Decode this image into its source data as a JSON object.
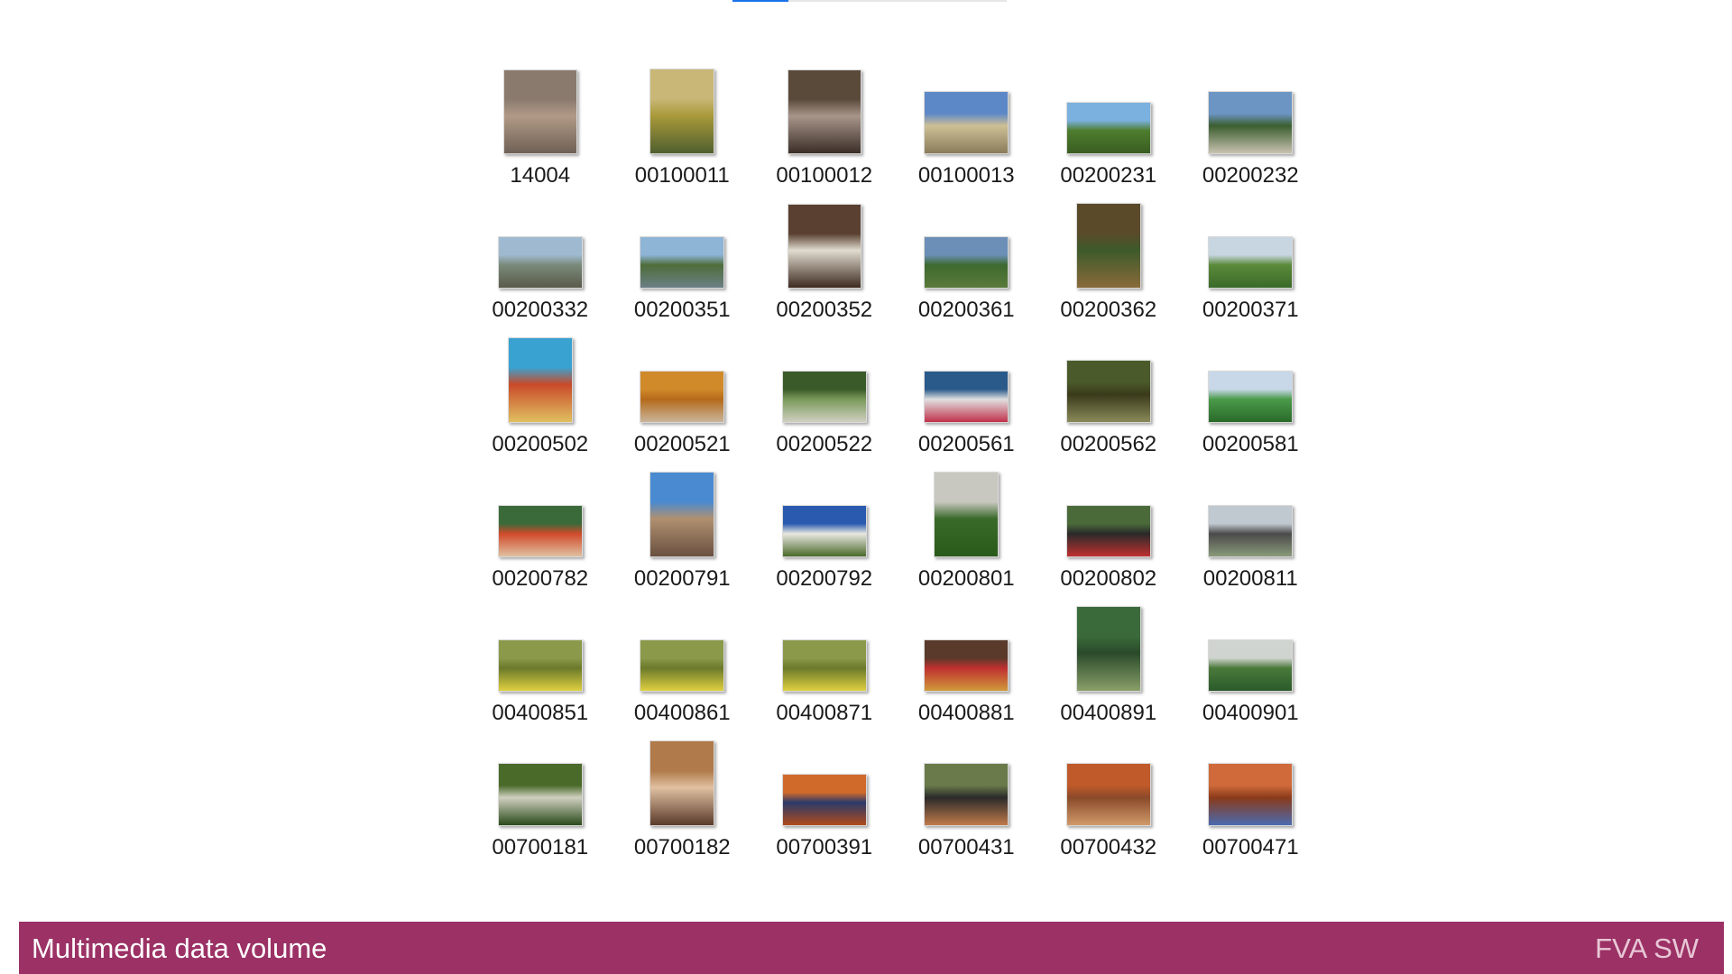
{
  "files": [
    {
      "name": "14004",
      "shape": "sq",
      "colors": [
        "#8a7a6e",
        "#b19a86",
        "#6f6156"
      ]
    },
    {
      "name": "00100011",
      "shape": "port",
      "colors": [
        "#c9b777",
        "#aa9a3a",
        "#4f5f2f"
      ]
    },
    {
      "name": "00100012",
      "shape": "sq",
      "colors": [
        "#5a4a3a",
        "#a8958a",
        "#3a2e28"
      ]
    },
    {
      "name": "00100013",
      "shape": "land",
      "colors": [
        "#5d88c7",
        "#cdbf95",
        "#8a7c5a"
      ]
    },
    {
      "name": "00200231",
      "shape": "wide",
      "colors": [
        "#7bb1de",
        "#4e7d2e",
        "#3a5d22"
      ]
    },
    {
      "name": "00200232",
      "shape": "land",
      "colors": [
        "#6c95c4",
        "#3b5e2f",
        "#c8c2b0"
      ]
    },
    {
      "name": "00200332",
      "shape": "wide",
      "colors": [
        "#9fbad0",
        "#7a8a7a",
        "#5a5a4a"
      ]
    },
    {
      "name": "00200351",
      "shape": "wide",
      "colors": [
        "#8eb4d6",
        "#4e6d3a",
        "#6b7f86"
      ]
    },
    {
      "name": "00200352",
      "shape": "sq",
      "colors": [
        "#5a4030",
        "#e0dccf",
        "#3e2a20"
      ]
    },
    {
      "name": "00200361",
      "shape": "wide",
      "colors": [
        "#6b8fb7",
        "#3d6a2f",
        "#5a7a3a"
      ]
    },
    {
      "name": "00200362",
      "shape": "port",
      "colors": [
        "#5a4a2a",
        "#3d5a2a",
        "#8a6a3a"
      ]
    },
    {
      "name": "00200371",
      "shape": "wide",
      "colors": [
        "#c8d6e2",
        "#5b8a3a",
        "#3a6a2a"
      ]
    },
    {
      "name": "00200502",
      "shape": "port",
      "colors": [
        "#3aa2d0",
        "#c94a2a",
        "#e0c060"
      ]
    },
    {
      "name": "00200521",
      "shape": "wide",
      "colors": [
        "#d08a2a",
        "#b46a1a",
        "#c9b59a"
      ]
    },
    {
      "name": "00200522",
      "shape": "wide",
      "colors": [
        "#3a5a2a",
        "#7a9a5a",
        "#d0d0c0"
      ]
    },
    {
      "name": "00200561",
      "shape": "wide",
      "colors": [
        "#2a5a8a",
        "#e0e0e0",
        "#c0304a"
      ]
    },
    {
      "name": "00200562",
      "shape": "land",
      "colors": [
        "#4a5a2a",
        "#3a3a1a",
        "#8a8a5a"
      ]
    },
    {
      "name": "00200581",
      "shape": "wide",
      "colors": [
        "#c8d8e8",
        "#4a9a4a",
        "#2a6a2a"
      ]
    },
    {
      "name": "00200782",
      "shape": "wide",
      "colors": [
        "#3a6a3a",
        "#d04a2a",
        "#e0c0a0"
      ]
    },
    {
      "name": "00200791",
      "shape": "port",
      "colors": [
        "#4a8ad0",
        "#b09070",
        "#6a5040"
      ]
    },
    {
      "name": "00200792",
      "shape": "wide",
      "colors": [
        "#2a5ab0",
        "#e8e8e0",
        "#4a6a2a"
      ]
    },
    {
      "name": "00200801",
      "shape": "port",
      "colors": [
        "#c8c8c0",
        "#3a6a2a",
        "#2a5a1a"
      ]
    },
    {
      "name": "00200802",
      "shape": "wide",
      "colors": [
        "#4a6a3a",
        "#2a2a2a",
        "#c03030"
      ]
    },
    {
      "name": "00200811",
      "shape": "wide",
      "colors": [
        "#c0c8d0",
        "#4a4a4a",
        "#8a9a7a"
      ]
    },
    {
      "name": "00400851",
      "shape": "wide",
      "colors": [
        "#8a9a4a",
        "#6a7a2a",
        "#e0d040"
      ]
    },
    {
      "name": "00400861",
      "shape": "wide",
      "colors": [
        "#8a9a4a",
        "#6a7a2a",
        "#e0d040"
      ]
    },
    {
      "name": "00400871",
      "shape": "wide",
      "colors": [
        "#8a9a4a",
        "#6a7a2a",
        "#e0d040"
      ]
    },
    {
      "name": "00400881",
      "shape": "wide",
      "colors": [
        "#5a3a2a",
        "#c03030",
        "#d09a3a"
      ]
    },
    {
      "name": "00400891",
      "shape": "port",
      "colors": [
        "#3a6a3a",
        "#2a4a2a",
        "#8aa06a"
      ]
    },
    {
      "name": "00400901",
      "shape": "wide",
      "colors": [
        "#d0d4d0",
        "#4a7a3a",
        "#2a5a2a"
      ]
    },
    {
      "name": "00700181",
      "shape": "land",
      "colors": [
        "#4a6a2a",
        "#d0d0c0",
        "#2a4a1a"
      ]
    },
    {
      "name": "00700182",
      "shape": "port",
      "colors": [
        "#b07a4a",
        "#e0c0a0",
        "#5a3a2a"
      ]
    },
    {
      "name": "00700391",
      "shape": "wide",
      "colors": [
        "#d06a2a",
        "#2a3a6a",
        "#b04a1a"
      ]
    },
    {
      "name": "00700431",
      "shape": "land",
      "colors": [
        "#6a7a4a",
        "#2a2a2a",
        "#c07a4a"
      ]
    },
    {
      "name": "00700432",
      "shape": "land",
      "colors": [
        "#c05a2a",
        "#8a4a2a",
        "#d09a6a"
      ]
    },
    {
      "name": "00700471",
      "shape": "land",
      "colors": [
        "#d06a3a",
        "#8a3a1a",
        "#4a6ab0"
      ]
    }
  ],
  "footer": {
    "title": "Multimedia data volume",
    "brand": "FVA SW"
  }
}
